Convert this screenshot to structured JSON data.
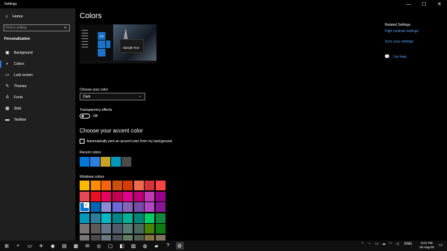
{
  "window": {
    "title": "Settings",
    "controls": {
      "minimize": "—",
      "maximize": "☐",
      "close": "✕"
    }
  },
  "sidebar": {
    "home_label": "Home",
    "search_placeholder": "Find a setting",
    "section": "Personalization",
    "items": [
      {
        "label": "Background",
        "icon": "image-icon",
        "glyph": "▣",
        "active": false
      },
      {
        "label": "Colors",
        "icon": "palette-icon",
        "glyph": "◐",
        "active": true
      },
      {
        "label": "Lock screen",
        "icon": "lock-screen-icon",
        "glyph": "▭",
        "active": false
      },
      {
        "label": "Themes",
        "icon": "brush-icon",
        "glyph": "✎",
        "active": false
      },
      {
        "label": "Fonts",
        "icon": "fonts-icon",
        "glyph": "A",
        "active": false
      },
      {
        "label": "Start",
        "icon": "start-icon",
        "glyph": "▦",
        "active": false
      },
      {
        "label": "Taskbar",
        "icon": "taskbar-icon",
        "glyph": "▬",
        "active": false
      }
    ]
  },
  "main": {
    "title": "Colors",
    "preview": {
      "sample_text": "Sample Text",
      "tile_label": "Aa"
    },
    "choose_color_label": "Choose your color",
    "choose_color_value": "Dark",
    "transparency_label": "Transparency effects",
    "transparency_state": "Off",
    "accent_heading": "Choose your accent color",
    "auto_pick_label": "Automatically pick an accent color from my background",
    "recent_label": "Recent colors",
    "recent_colors": [
      "#0078d7",
      "#2d7de0",
      "#c9a227",
      "#0099bc",
      "#4c4a48"
    ],
    "windows_label": "Windows colors",
    "windows_colors": [
      "#ffb900",
      "#ff8c00",
      "#f7630c",
      "#ca5010",
      "#da3b01",
      "#ef6950",
      "#d13438",
      "#ff4343",
      "#e74856",
      "#e81123",
      "#ea005e",
      "#c30052",
      "#e3008c",
      "#bf0077",
      "#c239b3",
      "#9a0089",
      "#0078d7",
      "#0063b1",
      "#8e8cd8",
      "#6b69d6",
      "#8764b8",
      "#744da9",
      "#b146c2",
      "#881798",
      "#0099bc",
      "#2d7d9a",
      "#00b7c3",
      "#038387",
      "#00b294",
      "#018574",
      "#00cc6a",
      "#10893e",
      "#7a7574",
      "#5d5a58",
      "#68768a",
      "#515c6b",
      "#567c73",
      "#486860",
      "#498205",
      "#107c10",
      "#767676",
      "#4c4a48",
      "#69797e",
      "#4a5459",
      "#647c64",
      "#525e54",
      "#847545",
      "#7e735f"
    ],
    "selected_index": 16
  },
  "related": {
    "title": "Related Settings",
    "links": [
      "High contrast settings",
      "Sync your settings"
    ],
    "help": "Get help"
  },
  "taskbar": {
    "icons": [
      {
        "name": "start-icon",
        "glyph": "⊞"
      },
      {
        "name": "search-icon",
        "glyph": "⌕"
      },
      {
        "name": "task-view-icon",
        "glyph": "▭"
      },
      {
        "name": "telegram-icon",
        "glyph": "✈"
      },
      {
        "name": "whatsapp-icon",
        "glyph": "◉"
      },
      {
        "name": "notes-icon",
        "glyph": "▤"
      },
      {
        "name": "spreadsheet-icon",
        "glyph": "▦"
      },
      {
        "name": "email-icon",
        "glyph": "✉"
      },
      {
        "name": "chrome-icon",
        "glyph": "◎"
      },
      {
        "name": "document-icon",
        "glyph": "▢"
      },
      {
        "name": "chat-icon",
        "glyph": "◧"
      },
      {
        "name": "photos-icon",
        "glyph": "▨"
      },
      {
        "name": "edge-icon",
        "glyph": "◍"
      },
      {
        "name": "explorer-icon",
        "glyph": "▰"
      },
      {
        "name": "help-icon",
        "glyph": "?"
      },
      {
        "name": "settings-icon",
        "glyph": "⚙",
        "active": true
      }
    ],
    "tray_lang": "ENG",
    "time": "9:01 PM",
    "date": "24-Aug-20"
  }
}
